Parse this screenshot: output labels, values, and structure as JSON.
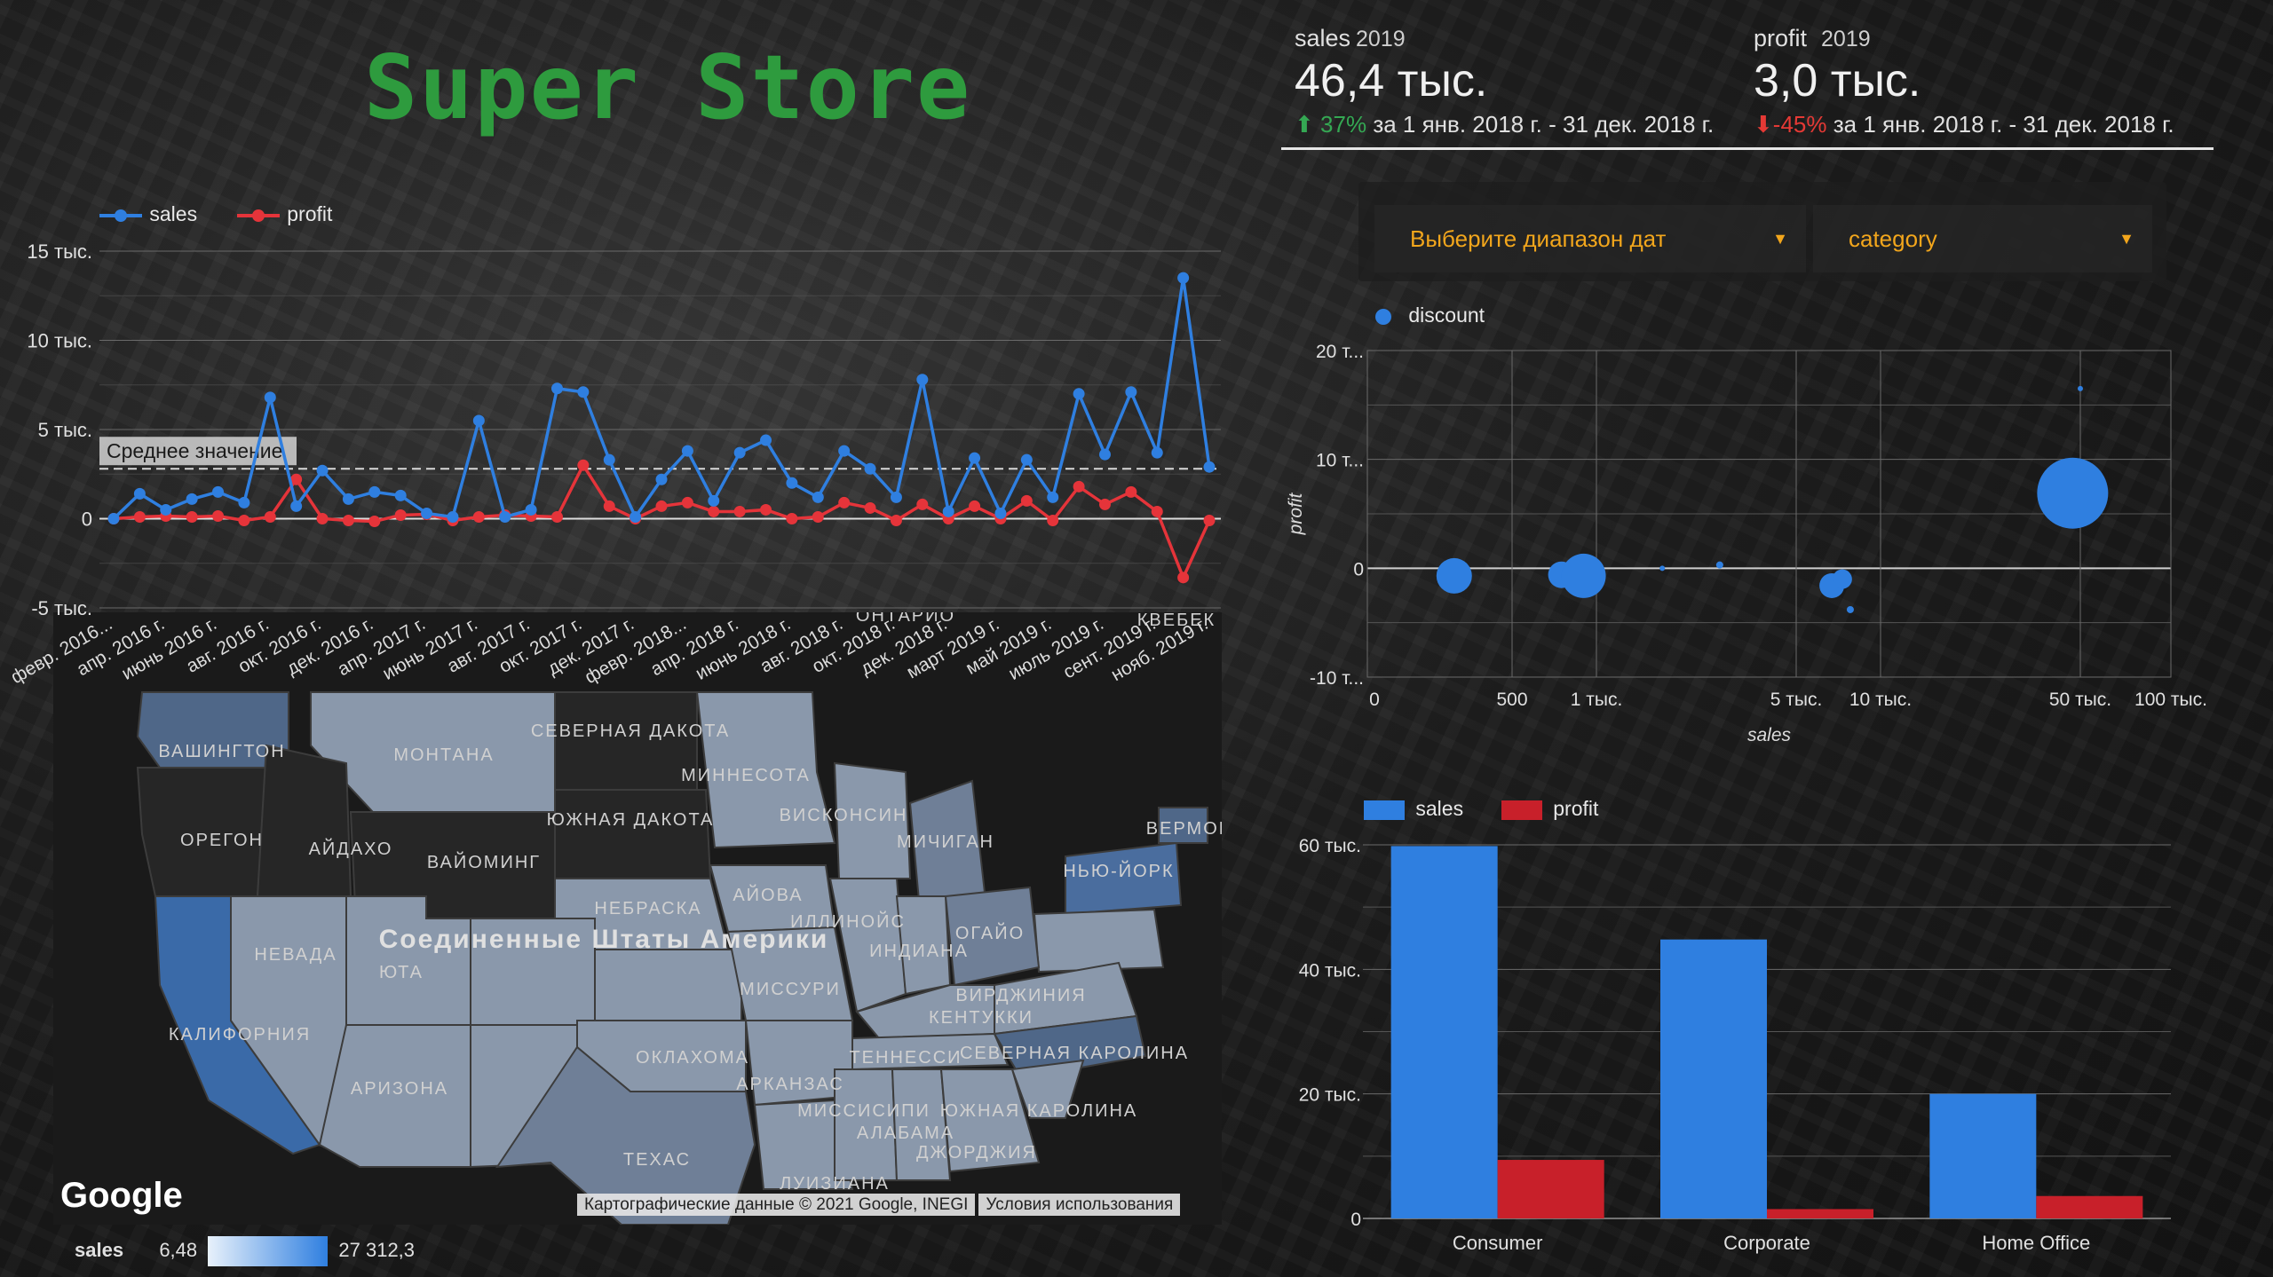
{
  "header": {
    "title": "Super Store"
  },
  "kpis": [
    {
      "label": "sales",
      "year": "2019",
      "value": "46,4 тыс.",
      "arrow": "⬆",
      "change": "37%",
      "trend": "up",
      "period": "за 1 янв. 2018 г. - 31 дек. 2018 г."
    },
    {
      "label": "profit",
      "year": "2019",
      "value": "3,0 тыс.",
      "arrow": "⬇",
      "change": "-45%",
      "trend": "down",
      "period": "за 1 янв. 2018 г. - 31 дек. 2018 г."
    }
  ],
  "controls": {
    "date_range_label": "Выберите диапазон дат",
    "category_label": "category",
    "accent_color": "#f2a61c"
  },
  "chart_data": [
    {
      "type": "line",
      "legend": [
        "sales",
        "profit"
      ],
      "colors": {
        "sales": "#2f7fe0",
        "profit": "#e5343a"
      },
      "y_ticks": [
        "15 тыс.",
        "10 тыс.",
        "5 тыс.",
        "0",
        "-5 тыс."
      ],
      "ylim": [
        -5000,
        15000
      ],
      "x_tick_labels": [
        "февр. 2016...",
        "апр. 2016 г.",
        "июнь 2016 г.",
        "авг. 2016 г.",
        "окт. 2016 г.",
        "дек. 2016 г.",
        "апр. 2017 г.",
        "июнь 2017 г.",
        "авг. 2017 г.",
        "окт. 2017 г.",
        "дек. 2017 г.",
        "февр. 2018...",
        "апр. 2018 г.",
        "июнь 2018 г.",
        "авг. 2018 г.",
        "окт. 2018 г.",
        "дек. 2018 г.",
        "март 2019 г.",
        "май 2019 г.",
        "июль 2019 г.",
        "сент. 2019 г.",
        "нояб. 2019 г."
      ],
      "average_label": "Среднее значение",
      "average_value": 2800,
      "series": [
        {
          "name": "sales",
          "values": [
            0,
            1400,
            500,
            1100,
            1500,
            900,
            6800,
            700,
            2700,
            1100,
            1500,
            1300,
            300,
            100,
            5500,
            100,
            500,
            7300,
            7100,
            3300,
            100,
            2200,
            3800,
            1000,
            3700,
            4400,
            2000,
            1200,
            3800,
            2800,
            1200,
            7800,
            400,
            3400,
            300,
            3300,
            1200,
            7000,
            3600,
            7100,
            3700,
            13500,
            2900
          ]
        },
        {
          "name": "profit",
          "values": [
            0,
            100,
            150,
            100,
            150,
            -100,
            100,
            2200,
            0,
            -100,
            -150,
            200,
            250,
            -100,
            100,
            200,
            150,
            100,
            3000,
            700,
            0,
            700,
            900,
            400,
            400,
            500,
            0,
            100,
            900,
            600,
            -100,
            800,
            0,
            700,
            0,
            1000,
            -100,
            1800,
            800,
            1500,
            400,
            -3300,
            -100
          ]
        }
      ]
    },
    {
      "type": "scatter",
      "legend": [
        "discount"
      ],
      "color": "#2f7fe0",
      "xlabel": "sales",
      "ylabel": "profit",
      "x_scale": "log",
      "x_ticks": [
        "0",
        "500",
        "1 тыс.",
        "5 тыс.",
        "10 тыс.",
        "50 тыс.",
        "100 тыс."
      ],
      "y_ticks": [
        "20 т...",
        "10 т...",
        "0",
        "-10 т..."
      ],
      "ylim": [
        -10000,
        20000
      ],
      "points": [
        {
          "x": 300,
          "y": -700,
          "r": 20
        },
        {
          "x": 750,
          "y": -600,
          "r": 15
        },
        {
          "x": 900,
          "y": -700,
          "r": 25
        },
        {
          "x": 1700,
          "y": 0,
          "r": 3
        },
        {
          "x": 2700,
          "y": 300,
          "r": 4
        },
        {
          "x": 6700,
          "y": -1600,
          "r": 14
        },
        {
          "x": 7300,
          "y": -1000,
          "r": 11
        },
        {
          "x": 7800,
          "y": -3800,
          "r": 4
        },
        {
          "x": 47000,
          "y": 6900,
          "r": 40
        },
        {
          "x": 50000,
          "y": 16500,
          "r": 3
        }
      ]
    },
    {
      "type": "bar",
      "legend": [
        "sales",
        "profit"
      ],
      "colors": {
        "sales": "#2f7fe0",
        "profit": "#c8202a"
      },
      "categories": [
        "Consumer",
        "Corporate",
        "Home Office"
      ],
      "y_ticks": [
        "60 тыс.",
        "40 тыс.",
        "20 тыс.",
        "0"
      ],
      "ylim": [
        0,
        60000
      ],
      "series": [
        {
          "name": "sales",
          "values": [
            59800,
            44800,
            20000
          ]
        },
        {
          "name": "profit",
          "values": [
            9400,
            1500,
            3600
          ]
        }
      ]
    }
  ],
  "map": {
    "labels": [
      "ВАШИНГТОН",
      "МОНТАНА",
      "СЕВЕРНАЯ ДАКОТА",
      "МИННЕСОТА",
      "ОРЕГОН",
      "АЙДАХО",
      "ВАЙОМИНГ",
      "ЮЖНАЯ ДАКОТА",
      "ВИСКОНСИН",
      "МИЧИГАН",
      "НЬЮ-ЙОРК",
      "ВЕРМОН",
      "НЕБРАСКА",
      "АЙОВА",
      "ИЛЛИНОЙС",
      "ОГАЙО",
      "НЕВАДА",
      "ЮТА",
      "Соединенные Штаты Америки",
      "ИНДИАНА",
      "МИССУРИ",
      "ВИРДЖИНИЯ",
      "КЕНТУККИ",
      "КАЛИФОРНИЯ",
      "ОКЛАХОМА",
      "ТЕННЕССИ",
      "СЕВЕРНАЯ КАРОЛИНА",
      "АРИЗОНА",
      "АРКАНЗАС",
      "МИССИСИПИ",
      "АЛАБАМА",
      "ЮЖНАЯ КАРОЛИНА",
      "ТЕХАС",
      "ДЖОРДЖИЯ",
      "ЛУИЗИАНА",
      "ОНТАРИО",
      "КВЕБЕК"
    ],
    "attribution": "Картографические данные © 2021 Google, INEGI",
    "terms": "Условия использования",
    "logo": "Google",
    "legend_metric": "sales",
    "legend_min": "6,48",
    "legend_max": "27 312,3"
  }
}
